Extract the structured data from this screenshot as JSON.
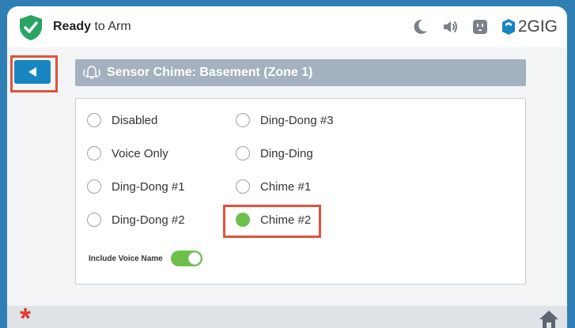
{
  "status": {
    "bold": "Ready",
    "rest": " to Arm"
  },
  "brand": {
    "logo": "2GIG"
  },
  "header": {
    "title": "Sensor Chime: Basement (Zone 1)"
  },
  "options": [
    {
      "label": "Disabled",
      "selected": false
    },
    {
      "label": "Ding-Dong #3",
      "selected": false
    },
    {
      "label": "Voice Only",
      "selected": false
    },
    {
      "label": "Ding-Ding",
      "selected": false
    },
    {
      "label": "Ding-Dong #1",
      "selected": false
    },
    {
      "label": "Chime #1",
      "selected": false
    },
    {
      "label": "Ding-Dong #2",
      "selected": false
    },
    {
      "label": "Chime #2",
      "selected": true
    }
  ],
  "voice_name": {
    "label": "Include Voice Name",
    "on": true
  },
  "colors": {
    "accent": "#1786c0",
    "selected": "#6cc04a",
    "highlight": "#e0533a",
    "shield": "#2aa463",
    "frame": "#2f7fb5"
  },
  "icons": [
    "shield-check-icon",
    "moon-icon",
    "speaker-icon",
    "outlet-icon",
    "brand-logo-icon",
    "back-arrow-icon",
    "chime-bell-icon",
    "asterisk-icon",
    "home-icon"
  ]
}
